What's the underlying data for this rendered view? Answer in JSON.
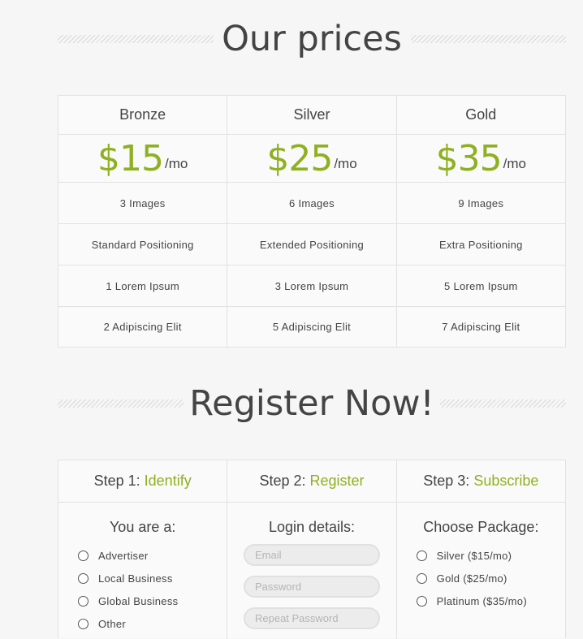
{
  "prices_section": {
    "title": "Our prices",
    "plans": [
      {
        "name": "Bronze",
        "price": "$15",
        "unit": "/mo",
        "features": [
          "3 Images",
          "Standard Positioning",
          "1 Lorem Ipsum",
          "2 Adipiscing Elit"
        ]
      },
      {
        "name": "Silver",
        "price": "$25",
        "unit": "/mo",
        "features": [
          "6 Images",
          "Extended Positioning",
          "3 Lorem Ipsum",
          "5 Adipiscing Elit"
        ]
      },
      {
        "name": "Gold",
        "price": "$35",
        "unit": "/mo",
        "features": [
          "9 Images",
          "Extra Positioning",
          "5 Lorem Ipsum",
          "7 Adipiscing Elit"
        ]
      }
    ]
  },
  "register_section": {
    "title": "Register Now!",
    "steps": [
      {
        "prefix": "Step 1: ",
        "name": "Identify"
      },
      {
        "prefix": "Step 2: ",
        "name": "Register"
      },
      {
        "prefix": "Step 3: ",
        "name": "Subscribe"
      }
    ],
    "identify": {
      "title": "You are a:",
      "options": [
        "Advertiser",
        "Local Business",
        "Global Business",
        "Other"
      ]
    },
    "login": {
      "title": "Login details:",
      "email_placeholder": "Email",
      "password_placeholder": "Password",
      "repeat_placeholder": "Repeat Password"
    },
    "package": {
      "title": "Choose Package:",
      "options": [
        "Silver ($15/mo)",
        "Gold ($25/mo)",
        "Platinum ($35/mo)"
      ]
    }
  },
  "colors": {
    "accent": "#8fb021",
    "text": "#444444",
    "border": "#e2e2e2"
  }
}
